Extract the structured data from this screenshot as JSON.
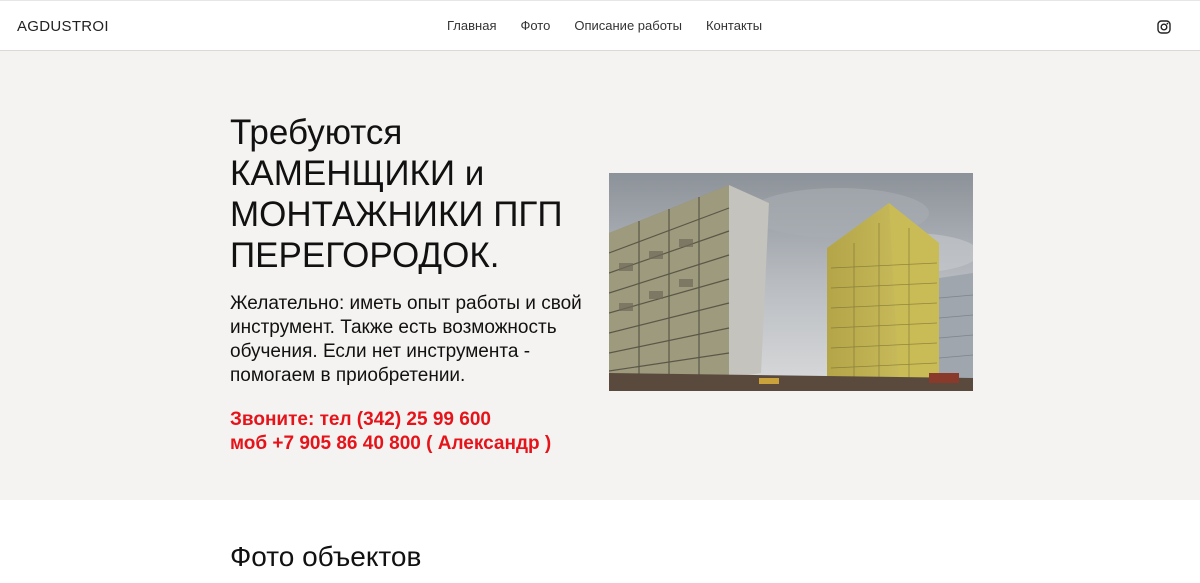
{
  "header": {
    "logo": "AGDUSTROI",
    "nav": [
      "Главная",
      "Фото",
      "Описание работы",
      "Контакты"
    ],
    "social_icon": "instagram-icon"
  },
  "hero": {
    "headline_lines": [
      "Требуются",
      "КАМЕНЩИКИ и",
      "МОНТАЖНИКИ ПГП",
      "ПЕРЕГОРОДОК."
    ],
    "description": "Желательно: иметь опыт работы и свой инструмент. Также есть возможность обучения. Если нет инструмента - помогаем в приобретении.",
    "phones": [
      "Звоните: тел (342) 25 99 600",
      "моб +7 905 86 40 800 ( Александр )"
    ],
    "image": "construction-buildings-photo"
  },
  "section": {
    "title": "Фото объектов"
  },
  "colors": {
    "hero_bg": "#f5f3f1",
    "phone_red": "#e5141a",
    "text": "#111111"
  }
}
